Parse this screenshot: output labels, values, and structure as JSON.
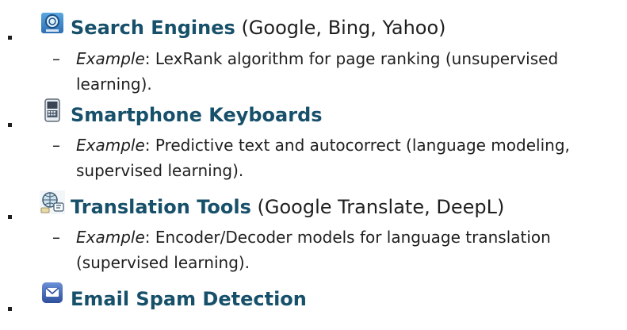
{
  "items": [
    {
      "icon": "search-engine-icon",
      "title": "Search Engines",
      "title_suffix": "(Google, Bing, Yahoo)",
      "example_label": "Example",
      "example_text": ": LexRank algorithm for page ranking (unsupervised learning)."
    },
    {
      "icon": "smartphone-keyboard-icon",
      "title": "Smartphone Keyboards",
      "title_suffix": "",
      "example_label": "Example",
      "example_text": ": Predictive text and autocorrect (language modeling, supervised learning)."
    },
    {
      "icon": "translation-tool-icon",
      "title": "Translation Tools",
      "title_suffix": "(Google Translate, DeepL)",
      "example_label": "Example",
      "example_text": ": Encoder/Decoder models for language translation (supervised learning)."
    },
    {
      "icon": "email-spam-icon",
      "title": "Email Spam Detection",
      "title_suffix": "",
      "example_label": "",
      "example_text": ""
    }
  ]
}
